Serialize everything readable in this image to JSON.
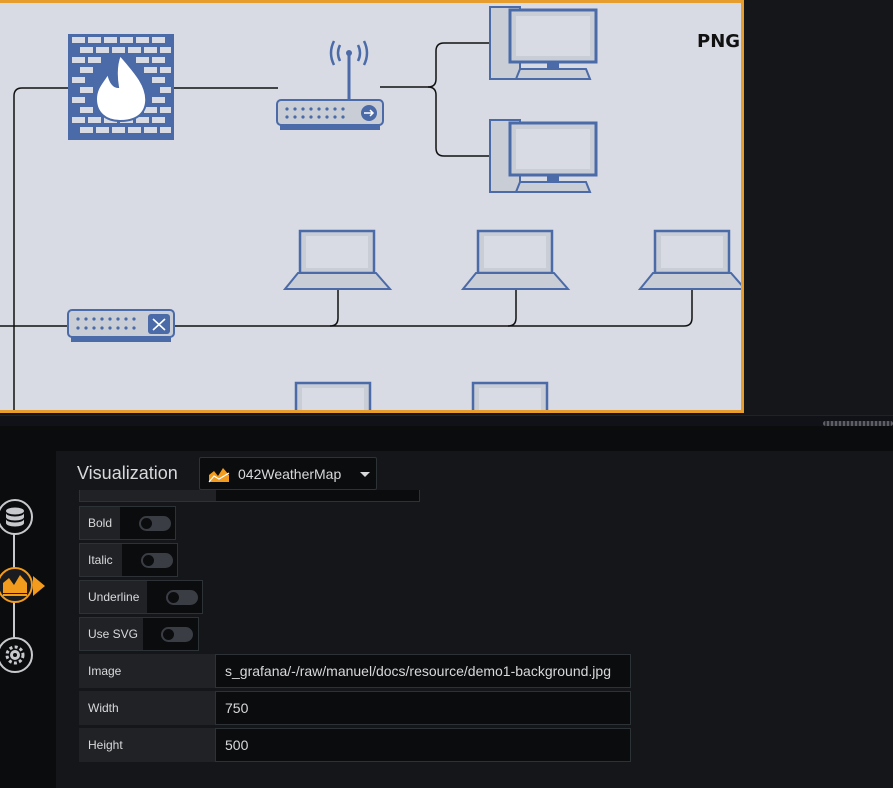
{
  "canvas": {
    "badge": "PNG"
  },
  "editor": {
    "section_title": "Visualization",
    "visualization_picker": {
      "selected": "042WeatherMap",
      "icon": "weathermap-plugin-icon"
    },
    "toggles": [
      {
        "label": "Bold",
        "on": false
      },
      {
        "label": "Italic",
        "on": false
      },
      {
        "label": "Underline",
        "on": false
      },
      {
        "label": "Use SVG",
        "on": false
      }
    ],
    "fields": [
      {
        "label": "Image",
        "value": "s_grafana/-/raw/manuel/docs/resource/demo1-background.jpg"
      },
      {
        "label": "Width",
        "value": "750"
      },
      {
        "label": "Height",
        "value": "500"
      }
    ]
  },
  "rail": {
    "icons": [
      "database-icon",
      "visualization-icon",
      "gear-icon"
    ]
  },
  "colors": {
    "accent": "#f29b1d",
    "panel_border": "#e79d2d",
    "canvas_bg": "#d8dbe3",
    "device_blue": "#4a6aa8"
  }
}
